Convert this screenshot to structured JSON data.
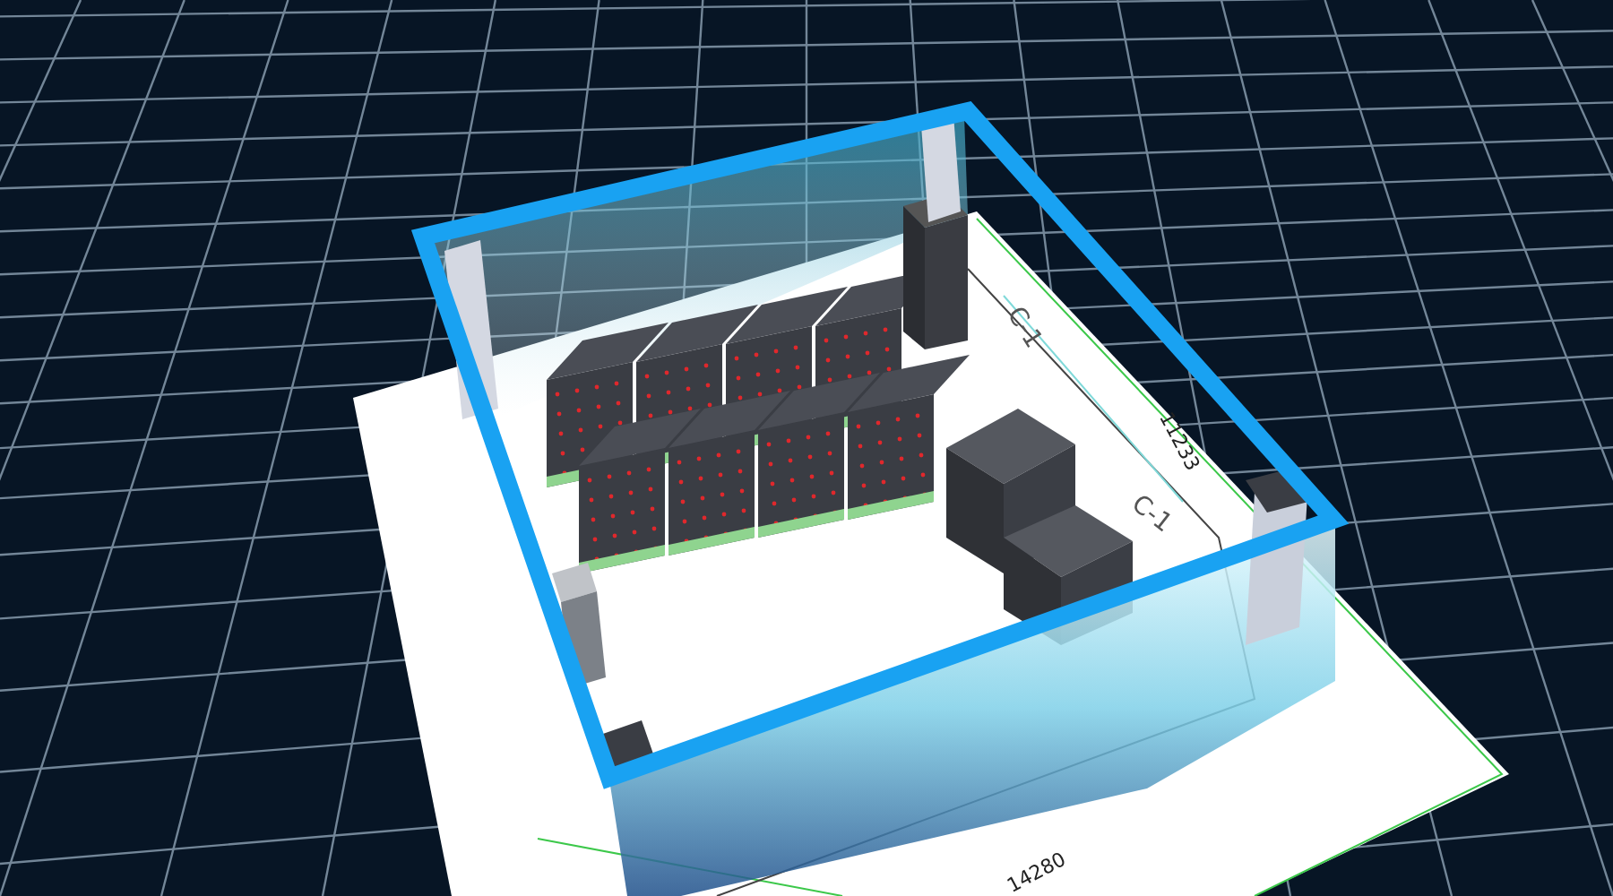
{
  "floor_plan": {
    "labels": [
      {
        "kind": "zone",
        "text": "C-1"
      },
      {
        "kind": "zone",
        "text": "C-1"
      },
      {
        "kind": "dimension",
        "text": "11233"
      },
      {
        "kind": "dimension",
        "text": "14280"
      }
    ]
  }
}
